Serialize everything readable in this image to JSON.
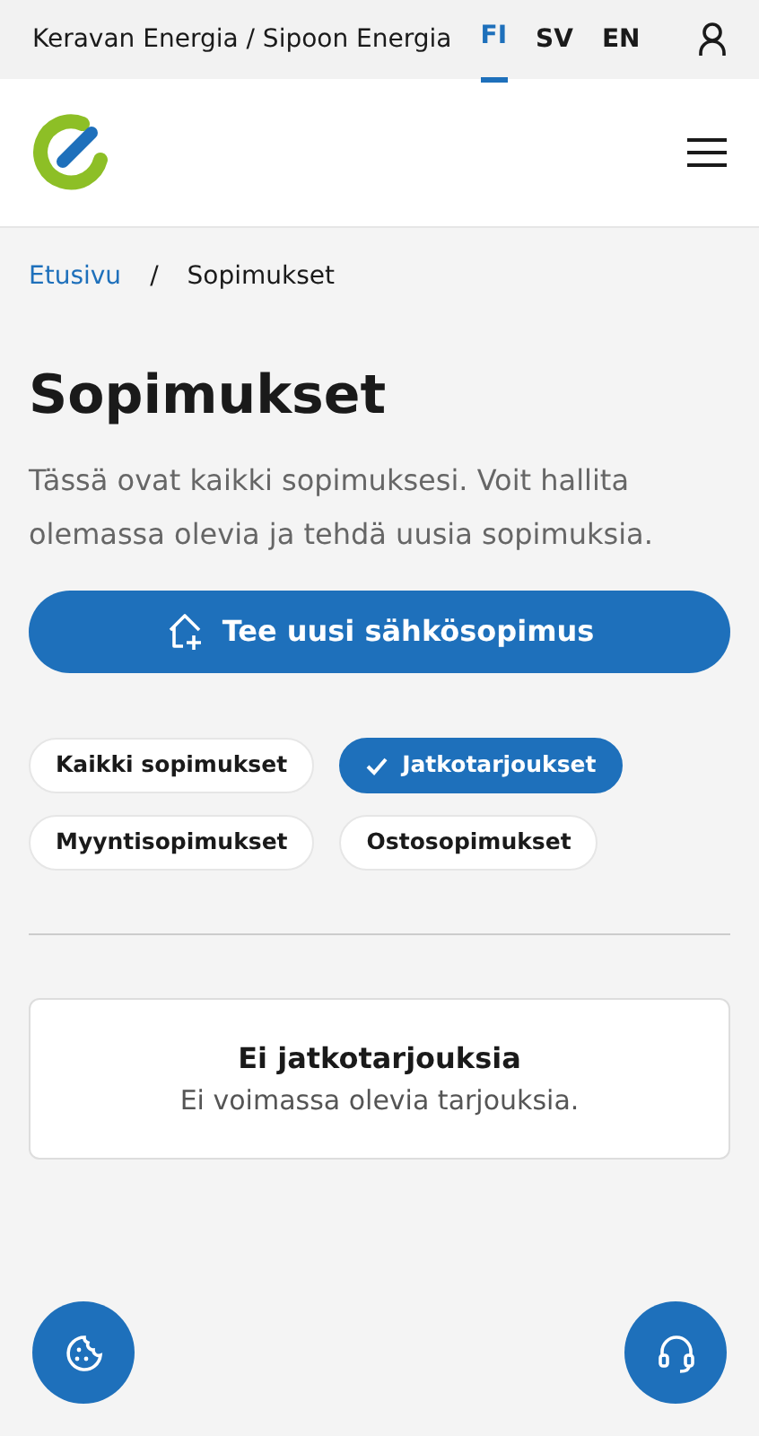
{
  "topbar": {
    "site": "Keravan Energia / Sipoon Energia",
    "languages": [
      {
        "label": "FI",
        "selected": true
      },
      {
        "label": "SV",
        "selected": false
      },
      {
        "label": "EN",
        "selected": false
      }
    ]
  },
  "breadcrumb": {
    "items": [
      "Etusivu",
      "Sopimukset"
    ],
    "separator": "/"
  },
  "title": "Sopimukset",
  "description": "Tässä ovat kaikki sopimuksesi. Voit hallita olemassa olevia ja tehdä uusia sopimuksia.",
  "primary_button": "Tee uusi sähkösopimus",
  "filters": [
    {
      "label": "Kaikki sopimukset",
      "selected": false
    },
    {
      "label": "Jatkotarjoukset",
      "selected": true
    },
    {
      "label": "Myyntisopimukset",
      "selected": false
    },
    {
      "label": "Ostosopimukset",
      "selected": false
    }
  ],
  "empty_state": {
    "title": "Ei jatkotarjouksia",
    "text": "Ei voimassa olevia tarjouksia."
  }
}
